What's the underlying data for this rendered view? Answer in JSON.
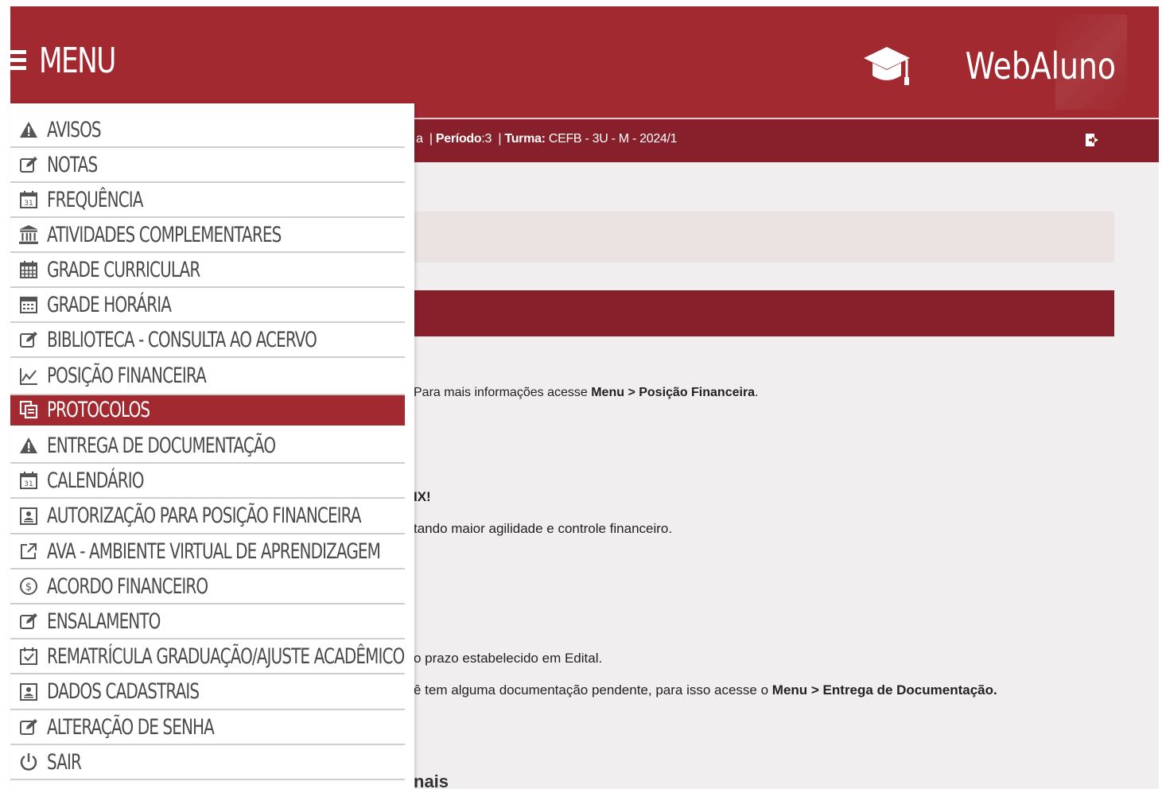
{
  "header": {
    "menu_label": "MENU",
    "brand_name": "WebAluno"
  },
  "infobar": {
    "partial_prefix": "a",
    "periodo_label": "Período",
    "periodo_value": ":3",
    "turma_label": "Turma:",
    "turma_value": "CEFB - 3U - M - 2024/1"
  },
  "content": {
    "line1_prefix": "Para mais informações acesse",
    "line1_bold": "Menu > Posição Financeira",
    "line1_suffix": ".",
    "line2_partial": "IX!",
    "line3_partial": "tando maior agilidade e controle financeiro.",
    "line4_partial": "o prazo estabelecido em Edital.",
    "line5_prefix": "ê tem alguma documentação pendente, para isso acesse o",
    "line5_bold": "Menu > Entrega de Documentação.",
    "heading_partial": "nais"
  },
  "sidebar": {
    "items": [
      {
        "label": "AVISOS",
        "icon": "warning-icon"
      },
      {
        "label": "NOTAS",
        "icon": "edit-icon"
      },
      {
        "label": "FREQUÊNCIA",
        "icon": "calendar-31-icon"
      },
      {
        "label": "ATIVIDADES COMPLEMENTARES",
        "icon": "institution-icon"
      },
      {
        "label": "GRADE CURRICULAR",
        "icon": "calendar-grid-icon"
      },
      {
        "label": "GRADE HORÁRIA",
        "icon": "calendar-table-icon"
      },
      {
        "label": "BIBLIOTECA - CONSULTA AO ACERVO",
        "icon": "edit-icon"
      },
      {
        "label": "POSIÇÃO FINANCEIRA",
        "icon": "line-chart-icon"
      },
      {
        "label": "PROTOCOLOS",
        "icon": "copy-icon",
        "active": true
      },
      {
        "label": "ENTREGA DE DOCUMENTAÇÃO",
        "icon": "warning-icon"
      },
      {
        "label": "CALENDÁRIO",
        "icon": "calendar-31-icon"
      },
      {
        "label": "AUTORIZAÇÃO PARA POSIÇÃO FINANCEIRA",
        "icon": "id-card-icon"
      },
      {
        "label": "AVA - AMBIENTE VIRTUAL DE APRENDIZAGEM",
        "icon": "external-link-icon"
      },
      {
        "label": "ACORDO FINANCEIRO",
        "icon": "dollar-circle-icon"
      },
      {
        "label": "ENSALAMENTO",
        "icon": "edit-icon"
      },
      {
        "label": "REMATRÍCULA GRADUAÇÃO/AJUSTE ACADÊMICO",
        "icon": "calendar-check-icon"
      },
      {
        "label": "DADOS CADASTRAIS",
        "icon": "id-card-icon"
      },
      {
        "label": "ALTERAÇÃO DE SENHA",
        "icon": "edit-icon"
      },
      {
        "label": "SAIR",
        "icon": "power-icon"
      }
    ]
  },
  "colors": {
    "primary": "#a1292f",
    "dark": "#87202a",
    "pink_panel": "#ebe2e2",
    "background": "#f1eeef"
  }
}
